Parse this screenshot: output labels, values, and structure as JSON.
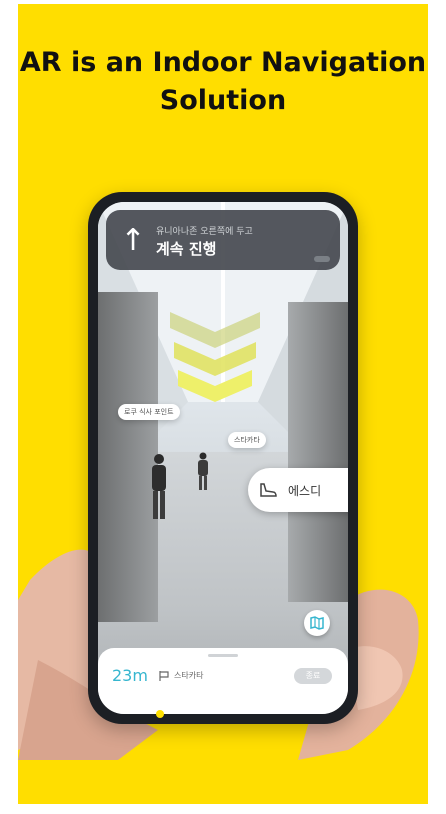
{
  "title": {
    "line1": "AR is an Indoor Navigation",
    "line2": "Solution"
  },
  "phone": {
    "banner": {
      "icon": "arrow-up-icon",
      "subtitle": "유니아나존 오른쪽에 두고",
      "instruction": "계속 진행"
    },
    "signs": {
      "left_sign": "로쿠 식사 포인트",
      "right_sign": "스타카타"
    },
    "poi": {
      "icon": "shoe-icon",
      "text": "에스디"
    },
    "map_button_icon": "map-icon",
    "bottom_sheet": {
      "distance": "23m",
      "destination_icon": "flag-icon",
      "destination": "스타카타",
      "end_button": "종료"
    }
  },
  "colors": {
    "background": "#ffde00",
    "accent": "#36b6cf",
    "chevron": "#eef06a"
  }
}
